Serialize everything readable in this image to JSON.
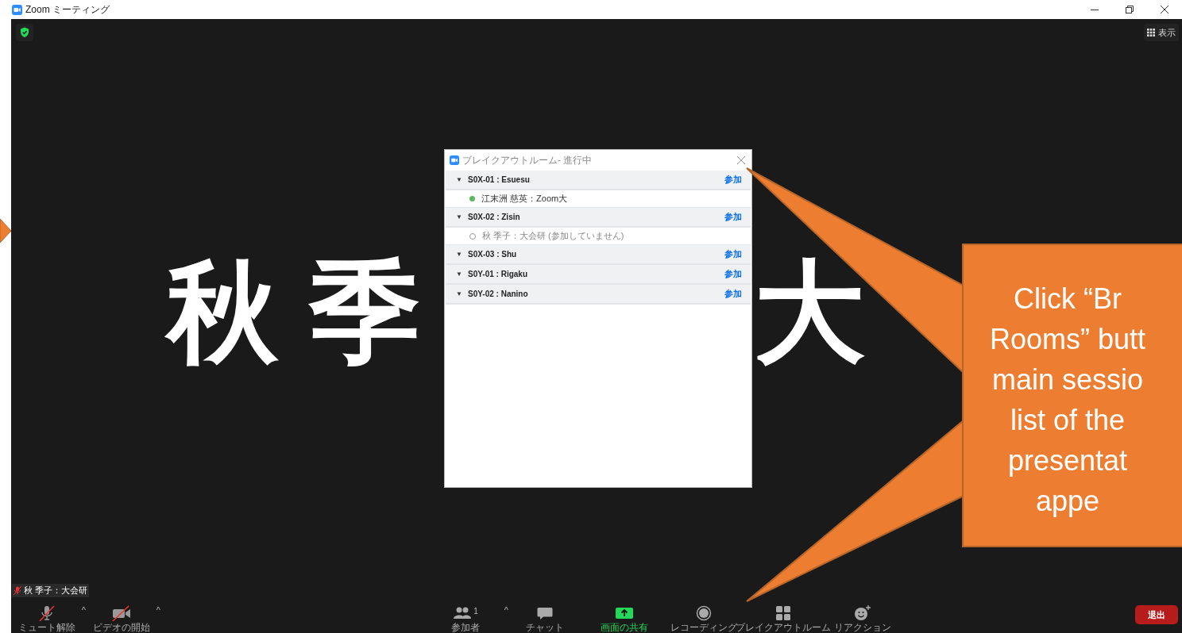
{
  "window": {
    "title": "Zoom ミーティング"
  },
  "view_button": {
    "label": "表示"
  },
  "video": {
    "name_pieces": [
      "秋 季",
      "大"
    ]
  },
  "breakout_dialog": {
    "title": "ブレイクアウトルーム- 進行中",
    "rooms": [
      {
        "toggle": "▼",
        "name": "S0X-01 : Esuesu",
        "join": "参加",
        "expanded": true,
        "participants": [
          {
            "name": "江末洲 慈英：Zoom大",
            "joined": true
          }
        ]
      },
      {
        "toggle": "▼",
        "name": "S0X-02 : Zisin",
        "join": "参加",
        "expanded": true,
        "participants": [
          {
            "name": "秋 季子：大会研 (参加していません)",
            "joined": false
          }
        ]
      },
      {
        "toggle": "▼",
        "name": "S0X-03 : Shu",
        "join": "参加",
        "expanded": true
      },
      {
        "toggle": "▼",
        "name": "S0Y-01 : Rigaku",
        "join": "参加",
        "expanded": true
      },
      {
        "toggle": "▼",
        "name": "S0Y-02 : Nanino",
        "join": "参加",
        "expanded": true
      }
    ]
  },
  "name_tag": {
    "name": "秋 季子：大会研",
    "muted": true
  },
  "toolbar": {
    "left": [
      {
        "kind": "mic",
        "label": "ミュート解除",
        "off": true,
        "menu_caret": "^",
        "highlighted": false
      },
      {
        "kind": "video",
        "label": "ビデオの開始",
        "off": true,
        "menu_caret": "^",
        "highlighted": false
      }
    ],
    "center": [
      {
        "kind": "participants",
        "label": "参加者",
        "count": "1",
        "menu_caret": "^",
        "highlighted": false
      },
      {
        "kind": "chat",
        "label": "チャット",
        "menu_caret": false,
        "highlighted": false
      },
      {
        "kind": "share",
        "label": "画面の共有",
        "menu_caret": false,
        "highlighted": true
      },
      {
        "kind": "record",
        "label": "レコーディング",
        "menu_caret": false,
        "highlighted": false
      },
      {
        "kind": "breakout",
        "label": "ブレイクアウトルーム",
        "menu_caret": false,
        "highlighted": false
      },
      {
        "kind": "reaction",
        "label": "リアクション",
        "menu_caret": false,
        "highlighted": false
      }
    ],
    "leave": "退出"
  },
  "callout": {
    "lines": [
      "Click “Br",
      "Rooms” butt",
      "main sessio",
      "list of the",
      "presentat",
      "appe"
    ]
  }
}
